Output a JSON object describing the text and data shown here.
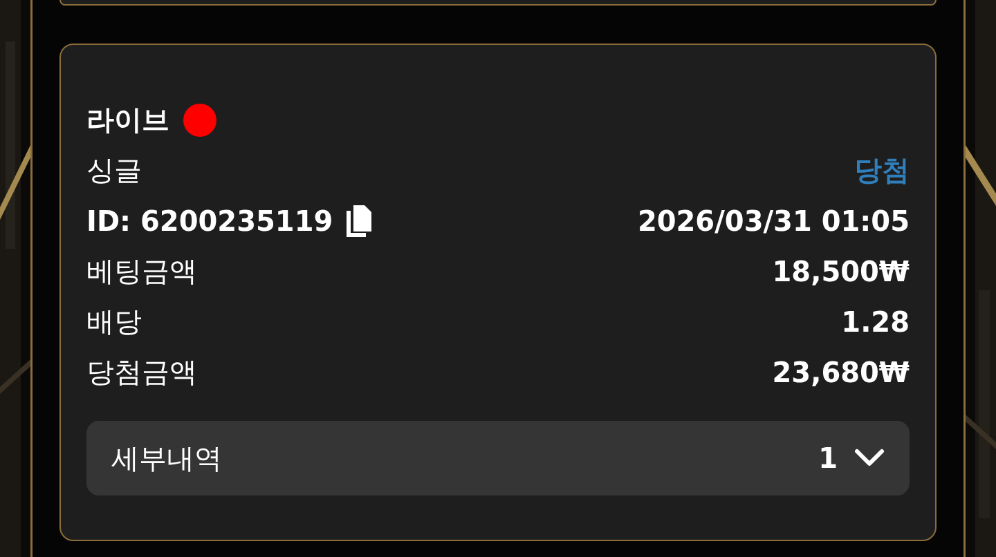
{
  "bet": {
    "type_label": "라이브",
    "live": true,
    "bet_kind": "싱글",
    "result": "당첨",
    "id": "ID: 6200235119",
    "datetime": "2026/03/31 01:05",
    "rows": [
      {
        "label": "베팅금액",
        "value": "18,500₩"
      },
      {
        "label": "배당",
        "value": "1.28"
      },
      {
        "label": "당첨금액",
        "value": "23,680₩"
      }
    ],
    "details": {
      "label": "세부내역",
      "count": "1",
      "expanded": false
    }
  }
}
